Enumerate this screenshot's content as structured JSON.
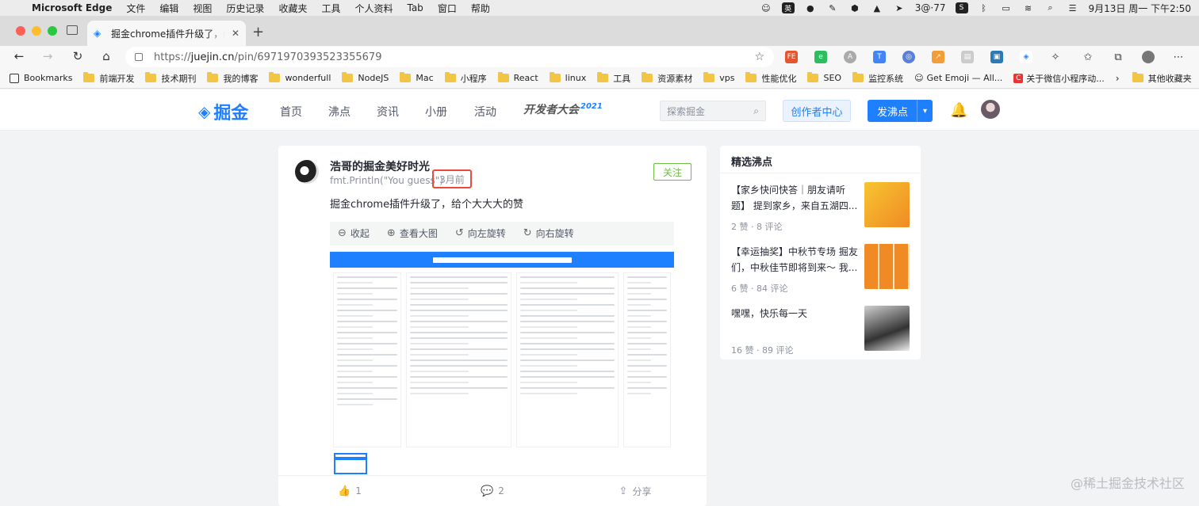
{
  "menubar": {
    "app": "Microsoft Edge",
    "menus": [
      "文件",
      "编辑",
      "视图",
      "历史记录",
      "收藏夹",
      "工具",
      "个人资料",
      "Tab",
      "窗口",
      "帮助"
    ],
    "status_text": "3@·77",
    "datetime": "9月13日 周一 下午2:50"
  },
  "browser": {
    "tab_title": "掘金chrome插件升级了，给个大大大的赞",
    "url_host_prefix": "https://",
    "url_host": "juejin.cn",
    "url_path": "/pin/6971970393523355679"
  },
  "bookmarks": {
    "items": [
      "Bookmarks",
      "前端开发",
      "技术期刊",
      "我的博客",
      "wonderfull",
      "NodeJS",
      "Mac",
      "小程序",
      "React",
      "linux",
      "工具",
      "资源素材",
      "vps",
      "性能优化",
      "SEO",
      "监控系统",
      "Get Emoji — All...",
      "关于微信小程序动..."
    ],
    "other": "其他收藏夹"
  },
  "juejin": {
    "logo": "掘金",
    "nav": [
      "首页",
      "沸点",
      "资讯",
      "小册",
      "活动"
    ],
    "conference": "开发者大会",
    "conference_year": "2021",
    "search_placeholder": "探索掘金",
    "creator_center": "创作者中心",
    "publish": "发沸点"
  },
  "post": {
    "author": "浩哥的掘金美好时光",
    "subtitle": "fmt.Println(\"You guess\")",
    "time": "3月前",
    "follow": "关注",
    "content": "掘金chrome插件升级了，给个大大大的赞",
    "viewer_actions": [
      "收起",
      "查看大图",
      "向左旋转",
      "向右旋转"
    ],
    "likes": "1",
    "comments": "2",
    "share": "分享"
  },
  "side": {
    "title": "精选沸点",
    "pins": [
      {
        "text": "【家乡快问快答｜朋友请听题】 提到家乡，来自五湖四...",
        "likes": "2 赞",
        "comments": "8 评论",
        "thumb_color": "#f5b21a"
      },
      {
        "text": "【幸运抽奖】中秋节专场 掘友们，中秋佳节即将到来～ 我...",
        "likes": "6 赞",
        "comments": "84 评论",
        "thumb_color": "#f08a24"
      },
      {
        "text": "嘿嘿，快乐每一天",
        "likes": "16 赞",
        "comments": "89 评论",
        "thumb_color": "#6b6b6b"
      }
    ]
  },
  "watermark": "@稀土掘金技术社区"
}
